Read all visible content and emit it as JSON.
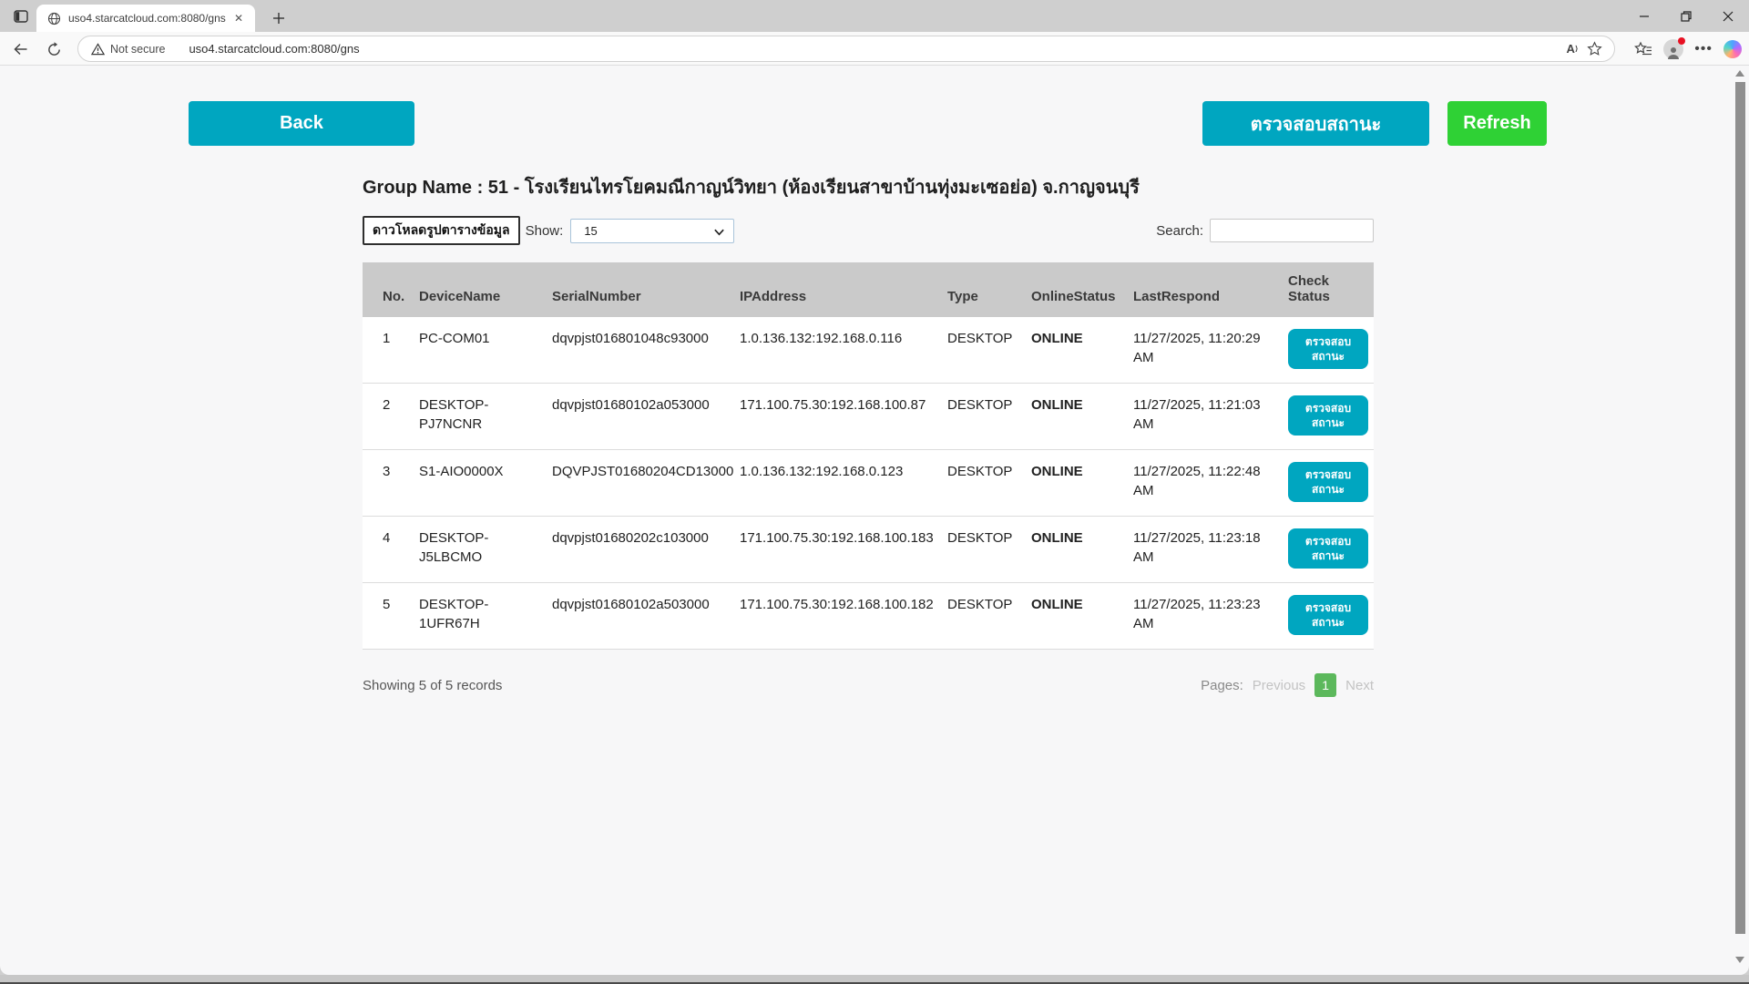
{
  "browser": {
    "tab_title": "uso4.starcatcloud.com:8080/gns",
    "security_label": "Not secure",
    "url": "uso4.starcatcloud.com:8080/gns"
  },
  "page": {
    "back_label": "Back",
    "check_status_label": "ตรวจสอบสถานะ",
    "refresh_label": "Refresh",
    "group_title": "Group Name : 51 - โรงเรียนไทรโยคมณีกาญน์วิทยา (ห้องเรียนสาขาบ้านทุ่งมะเซอย่อ) จ.กาญจนบุรี",
    "download_label": "ดาวโหลดรูปตารางข้อมูล",
    "show_label": "Show:",
    "show_value": "15",
    "search_label": "Search:",
    "search_value": "",
    "table": {
      "headers": [
        "No.",
        "DeviceName",
        "SerialNumber",
        "IPAddress",
        "Type",
        "OnlineStatus",
        "LastRespond",
        "Check Status"
      ],
      "action_label": "ตรวจสอบสถานะ",
      "rows": [
        {
          "no": "1",
          "device": "PC-COM01",
          "serial": "dqvpjst016801048c93000",
          "ip": "1.0.136.132:192.168.0.116",
          "type": "DESKTOP",
          "status": "ONLINE",
          "last": "11/27/2025, 11:20:29 AM"
        },
        {
          "no": "2",
          "device": "DESKTOP-PJ7NCNR",
          "serial": "dqvpjst01680102a053000",
          "ip": "171.100.75.30:192.168.100.87",
          "type": "DESKTOP",
          "status": "ONLINE",
          "last": "11/27/2025, 11:21:03 AM"
        },
        {
          "no": "3",
          "device": "S1-AIO0000X",
          "serial": "DQVPJST01680204CD13000",
          "ip": "1.0.136.132:192.168.0.123",
          "type": "DESKTOP",
          "status": "ONLINE",
          "last": "11/27/2025, 11:22:48 AM"
        },
        {
          "no": "4",
          "device": "DESKTOP-J5LBCMO",
          "serial": "dqvpjst01680202c103000",
          "ip": "171.100.75.30:192.168.100.183",
          "type": "DESKTOP",
          "status": "ONLINE",
          "last": "11/27/2025, 11:23:18 AM"
        },
        {
          "no": "5",
          "device": "DESKTOP-1UFR67H",
          "serial": "dqvpjst01680102a503000",
          "ip": "171.100.75.30:192.168.100.182",
          "type": "DESKTOP",
          "status": "ONLINE",
          "last": "11/27/2025, 11:23:23 AM"
        }
      ]
    },
    "footer": {
      "showing": "Showing 5 of 5 records",
      "pages_label": "Pages:",
      "previous": "Previous",
      "current_page": "1",
      "next": "Next"
    }
  },
  "colors": {
    "teal_button": "#00a6c0",
    "refresh_green": "#2fd135",
    "online_green": "#0a9b0a",
    "page_badge_green": "#5cb85c",
    "table_header_bg": "#cacaca"
  }
}
